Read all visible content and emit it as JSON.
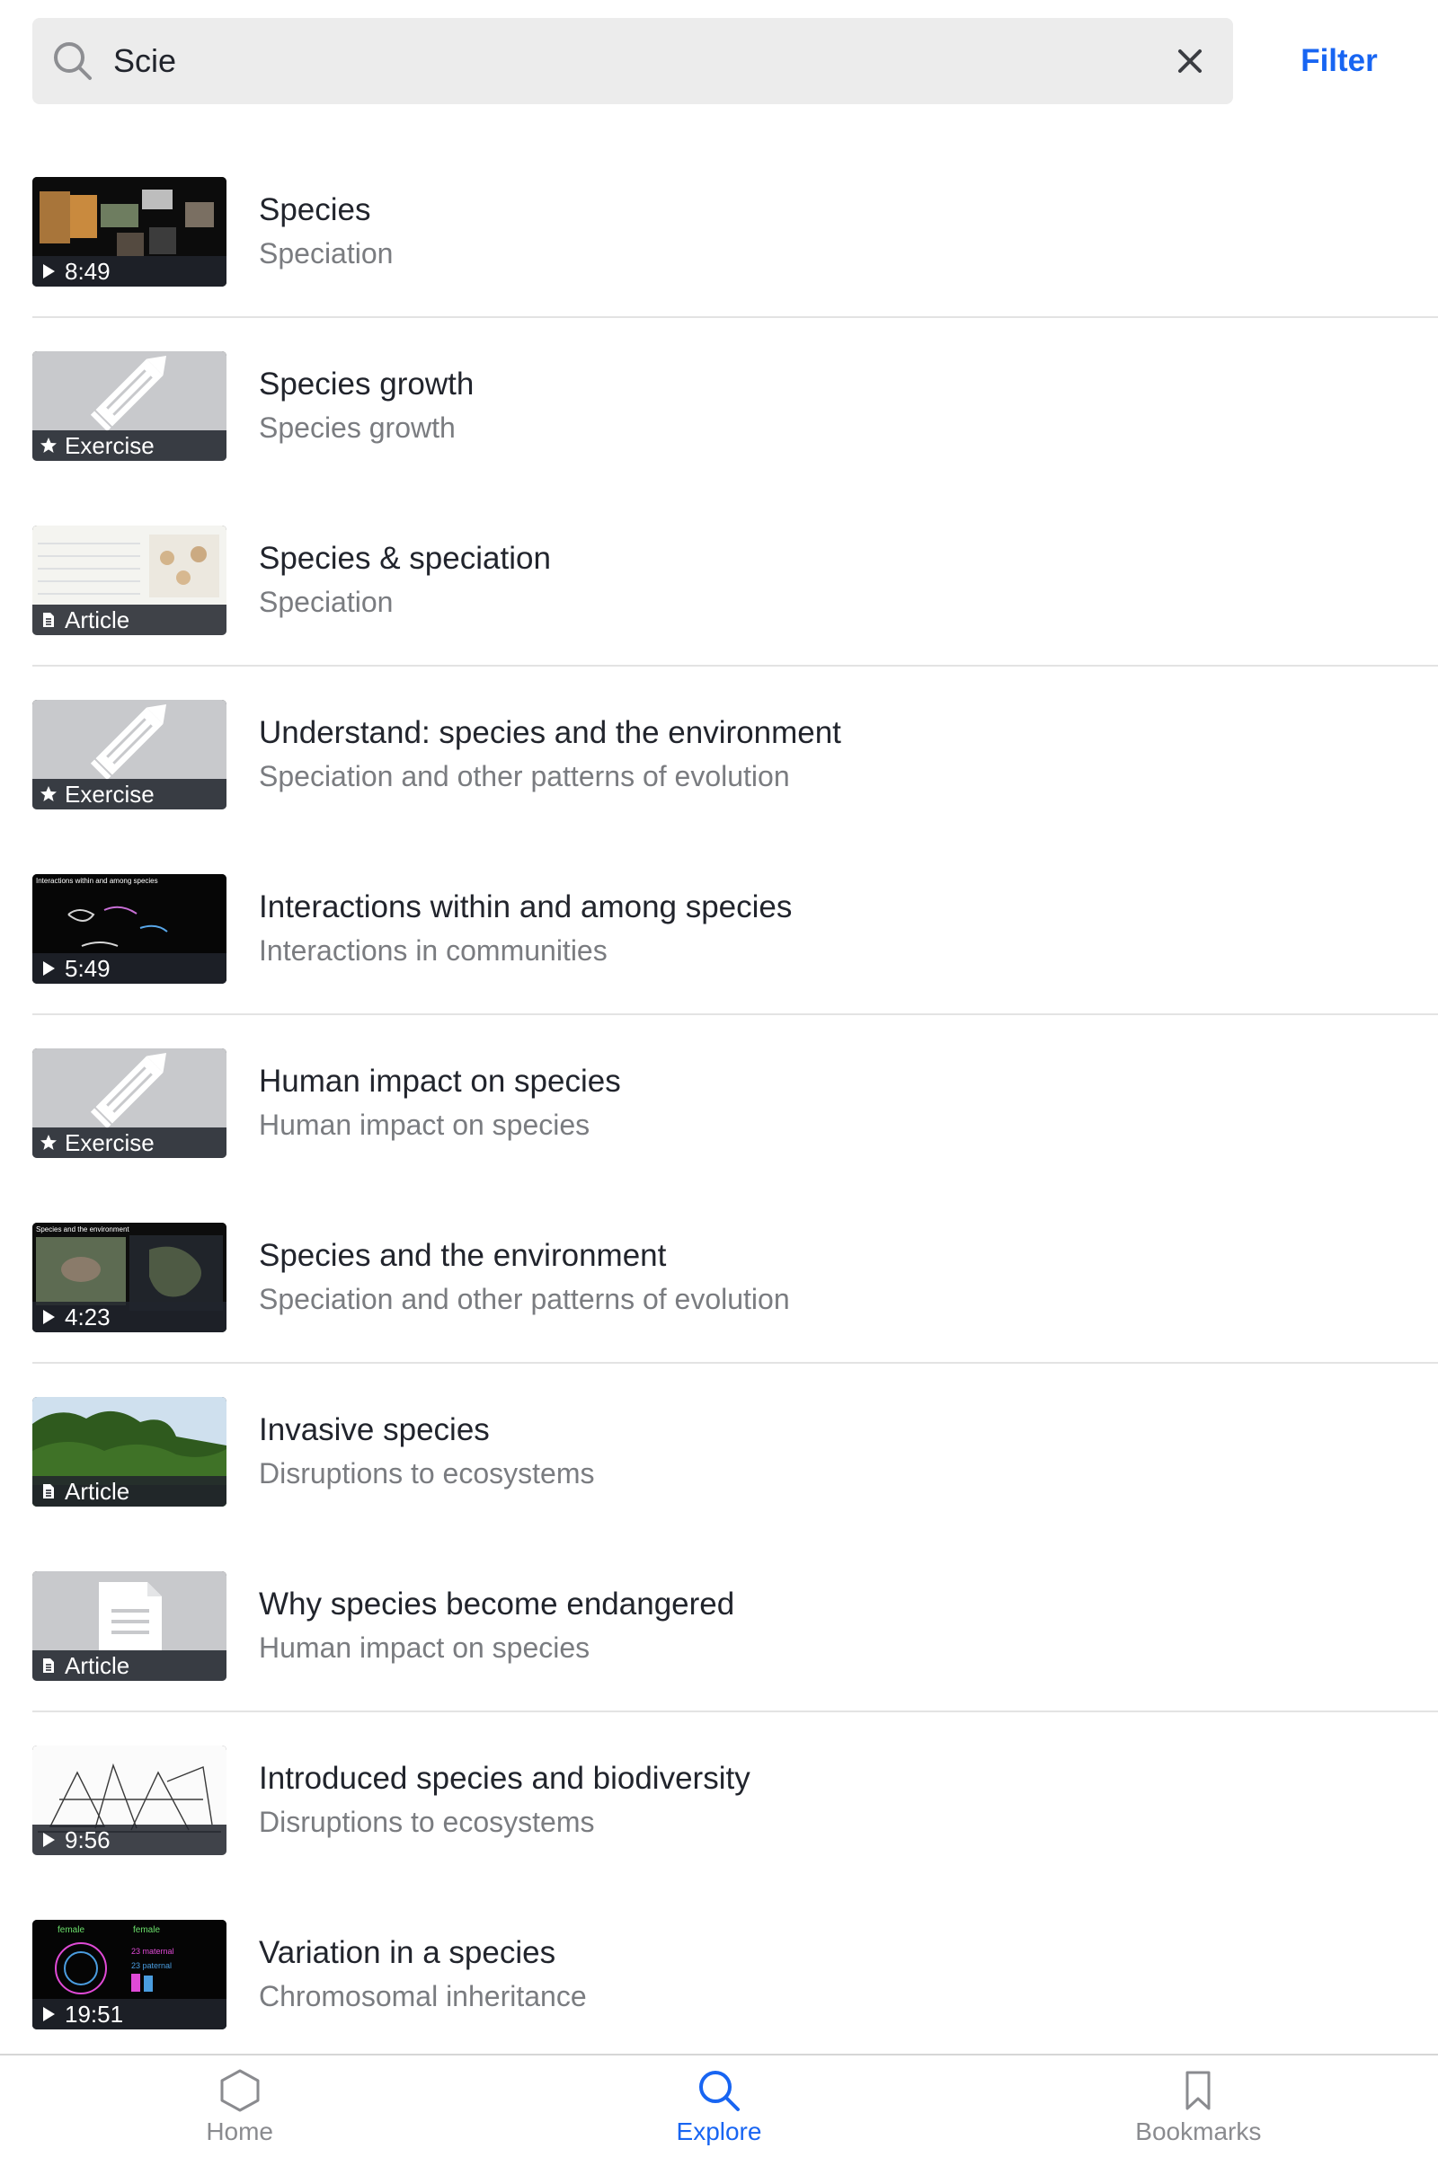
{
  "search": {
    "value": "Scie",
    "filter_label": "Filter"
  },
  "results": [
    {
      "title": "Species",
      "subtitle": "Speciation",
      "kind": "video",
      "badge": "8:49"
    },
    {
      "title": "Species growth",
      "subtitle": "Species growth",
      "kind": "exercise",
      "badge": "Exercise"
    },
    {
      "title": "Species & speciation",
      "subtitle": "Speciation",
      "kind": "article",
      "badge": "Article"
    },
    {
      "title": "Understand: species and the environment",
      "subtitle": "Speciation and other patterns of evolution",
      "kind": "exercise",
      "badge": "Exercise"
    },
    {
      "title": "Interactions within and among species",
      "subtitle": "Interactions in communities",
      "kind": "video",
      "badge": "5:49",
      "thumb_caption": "Interactions within and among species"
    },
    {
      "title": "Human impact on species",
      "subtitle": "Human impact on species",
      "kind": "exercise",
      "badge": "Exercise"
    },
    {
      "title": "Species and the environment",
      "subtitle": "Speciation and other patterns of evolution",
      "kind": "video",
      "badge": "4:23",
      "thumb_caption": "Species and the environment"
    },
    {
      "title": "Invasive species",
      "subtitle": "Disruptions to ecosystems",
      "kind": "article",
      "badge": "Article"
    },
    {
      "title": "Why species become endangered",
      "subtitle": "Human impact on species",
      "kind": "article",
      "badge": "Article"
    },
    {
      "title": "Introduced species and biodiversity",
      "subtitle": "Disruptions to ecosystems",
      "kind": "video",
      "badge": "9:56"
    },
    {
      "title": "Variation in a species",
      "subtitle": "Chromosomal inheritance",
      "kind": "video",
      "badge": "19:51",
      "thumb_caption": "female"
    }
  ],
  "nav": {
    "home": "Home",
    "explore": "Explore",
    "bookmarks": "Bookmarks",
    "active": "explore"
  },
  "colors": {
    "accent": "#1865f2",
    "search_bg": "#ececec",
    "muted_text": "#7a7c80",
    "badge_bg": "#21242c"
  }
}
